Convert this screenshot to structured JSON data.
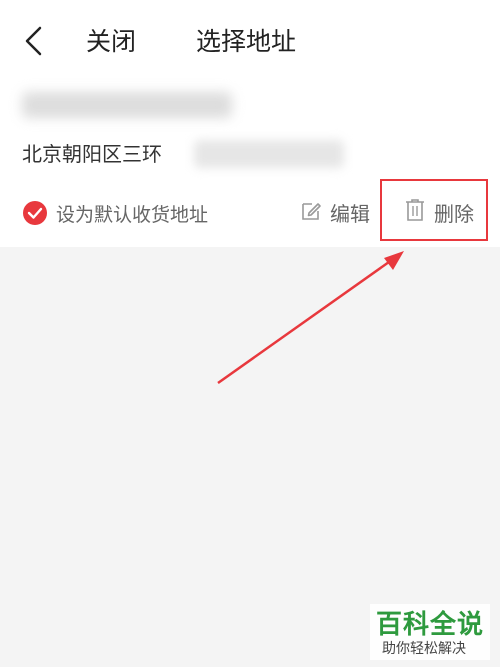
{
  "header": {
    "back_icon": "chevron-left-icon",
    "close_label": "关闭",
    "title": "选择地址"
  },
  "address_card": {
    "address_text": "北京朝阳区三环",
    "default_label": "设为默认收货地址",
    "default_checked": true,
    "edit_label": "编辑",
    "delete_label": "删除",
    "edit_icon": "edit-icon",
    "delete_icon": "trash-icon"
  },
  "colors": {
    "accent_red": "#e8383d",
    "watermark_green": "#2e9a3e",
    "background": "#f4f4f4"
  },
  "watermark": {
    "main": "百科全说",
    "sub": "助你轻松解决"
  }
}
